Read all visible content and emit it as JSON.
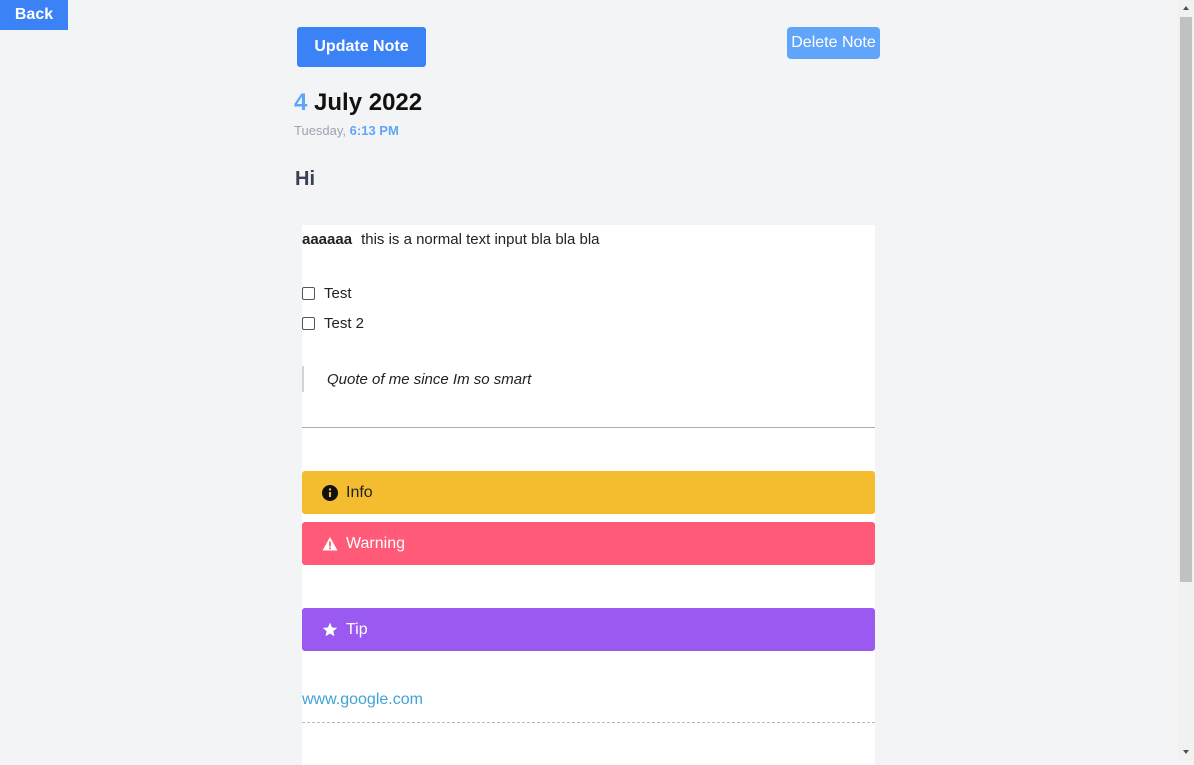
{
  "nav": {
    "back_label": "Back"
  },
  "actions": {
    "update_label": "Update Note",
    "delete_label": "Delete Note"
  },
  "date": {
    "day": "4",
    "month_year": "July 2022",
    "weekday": "Tuesday,",
    "time": "6:13 PM"
  },
  "note": {
    "title": "Hi",
    "line1_bold": "aaaaaa",
    "line1_text": "this is a normal text input bla bla bla",
    "checklist": [
      {
        "label": "Test",
        "checked": false
      },
      {
        "label": "Test 2",
        "checked": false
      }
    ],
    "quote": "Quote of me since Im so smart",
    "callouts": [
      {
        "type": "info",
        "label": "Info",
        "icon": "info-circle-icon",
        "color": "#f4bd2f"
      },
      {
        "type": "warning",
        "label": "Warning",
        "icon": "warning-triangle-icon",
        "color": "#ff5a78"
      },
      {
        "type": "tip",
        "label": "Tip",
        "icon": "star-icon",
        "color": "#9a59f0"
      }
    ],
    "link": "www.google.com"
  },
  "colors": {
    "accent": "#3b82f6",
    "accent_light": "#60a5fa",
    "link": "#3fa3d6",
    "background": "#f3f4f6"
  }
}
